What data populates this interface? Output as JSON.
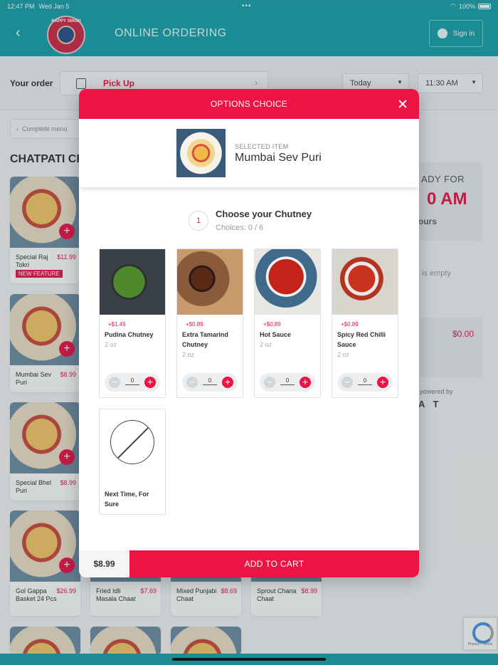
{
  "status": {
    "time": "12:47 PM",
    "date": "Wed Jan 5",
    "dots": "•••",
    "battery": "100%"
  },
  "header": {
    "title": "ONLINE ORDERING",
    "signin": "Sign in",
    "logo_text": "HAPPY SINGH"
  },
  "order": {
    "label": "Your order",
    "mode": "Pick Up",
    "day": "Today",
    "time": "11:30 AM"
  },
  "breadcrumb": "Complete menu",
  "category": "CHATPATI CH",
  "menu": [
    {
      "name": "Special Raj Tokri",
      "price": "$11.99",
      "tag": "NEW FEATURE"
    },
    {
      "name": "Mumbai Sev Puri",
      "price": "$8.99"
    },
    {
      "name": "Special Bhel Puri",
      "price": "$8.99"
    },
    {
      "name": "Gol Gappa Basket 24 Pcs",
      "price": "$26.99"
    },
    {
      "name": "Fried Idli Masala Chaat",
      "price": "$7.69"
    },
    {
      "name": "Mixed Punjabi Chaat",
      "price": "$8.69"
    },
    {
      "name": "Sprout Chana Chaat",
      "price": "$8.99"
    }
  ],
  "side": {
    "ready_a": "ADY FOR",
    "ready_b": "0 AM",
    "ready_c": "ours",
    "empty": "is empty",
    "total": "$0.00",
    "powered": "powered by",
    "brand": "A T"
  },
  "modal": {
    "title": "OPTIONS CHOICE",
    "selected_caption": "SELECTED ITEM",
    "selected_name": "Mumbai Sev Puri",
    "step_number": "1",
    "step_title": "Choose your Chutney",
    "step_choices": "Choices: 0 / 6",
    "options": [
      {
        "price": "+$1.49",
        "name": "Pudina Chutney",
        "size": "2 oz",
        "qty": "0"
      },
      {
        "price": "+$0.89",
        "name": "Extra Tamarind Chutney",
        "size": "2 oz",
        "qty": "0"
      },
      {
        "price": "+$0.89",
        "name": "Hot Sauce",
        "size": "2 oz",
        "qty": "0"
      },
      {
        "price": "+$0.89",
        "name": "Spicy Red Chilli Sauce",
        "size": "2 oz",
        "qty": "0"
      }
    ],
    "none_option": "Next Time, For Sure",
    "total": "$8.99",
    "add_to_cart": "ADD TO CART"
  },
  "recaptcha": "Privacy - Terms",
  "colors": {
    "accent": "#ec1444",
    "teal": "#199ea8"
  }
}
